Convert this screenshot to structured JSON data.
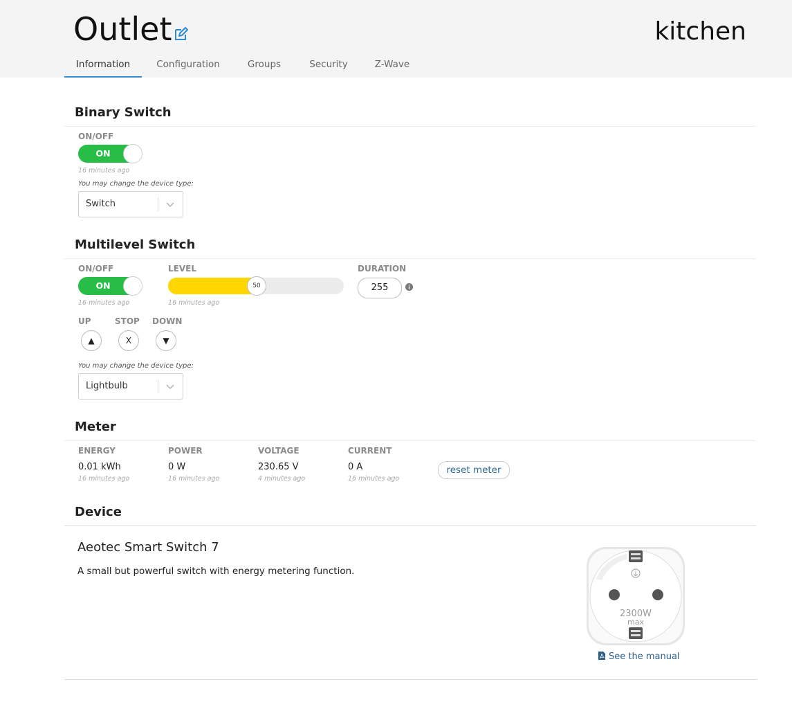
{
  "header": {
    "title": "Outlet",
    "room": "kitchen",
    "tabs": [
      {
        "label": "Information",
        "active": true
      },
      {
        "label": "Configuration",
        "active": false
      },
      {
        "label": "Groups",
        "active": false
      },
      {
        "label": "Security",
        "active": false
      },
      {
        "label": "Z-Wave",
        "active": false
      }
    ]
  },
  "binary_switch": {
    "title": "Binary Switch",
    "onoff_label": "ON/OFF",
    "toggle_text": "ON",
    "updated": "16 minutes ago",
    "type_note": "You may change the device type:",
    "type_value": "Switch"
  },
  "multilevel_switch": {
    "title": "Multilevel Switch",
    "onoff_label": "ON/OFF",
    "toggle_text": "ON",
    "onoff_updated": "16 minutes ago",
    "level_label": "LEVEL",
    "level_value": "50",
    "level_fraction": 0.5,
    "level_updated": "16 minutes ago",
    "duration_label": "DURATION",
    "duration_value": "255",
    "up_label": "UP",
    "stop_label": "STOP",
    "down_label": "DOWN",
    "up_symbol": "▲",
    "stop_symbol": "X",
    "down_symbol": "▼",
    "type_note": "You may change the device type:",
    "type_value": "Lightbulb"
  },
  "meter": {
    "title": "Meter",
    "readings": [
      {
        "label": "ENERGY",
        "value": "0.01 kWh",
        "updated": "16 minutes ago"
      },
      {
        "label": "POWER",
        "value": "0 W",
        "updated": "16 minutes ago"
      },
      {
        "label": "VOLTAGE",
        "value": "230.65 V",
        "updated": "4 minutes ago"
      },
      {
        "label": "CURRENT",
        "value": "0 A",
        "updated": "16 minutes ago"
      }
    ],
    "reset_label": "reset meter"
  },
  "device": {
    "title": "Device",
    "name": "Aeotec Smart Switch 7",
    "description": "A small but powerful switch with energy metering function.",
    "image_text_1": "2300W",
    "image_text_2": "max",
    "manual_label": "See the manual"
  },
  "colors": {
    "accent": "#2f8ad6",
    "toggle_on": "#28bd46",
    "level_fill": "#ffd600",
    "link": "#2c5f8a",
    "header_bg": "#f4f4f4"
  },
  "icons": [
    "edit-icon",
    "chevron-down-icon",
    "info-icon",
    "pdf-icon"
  ]
}
